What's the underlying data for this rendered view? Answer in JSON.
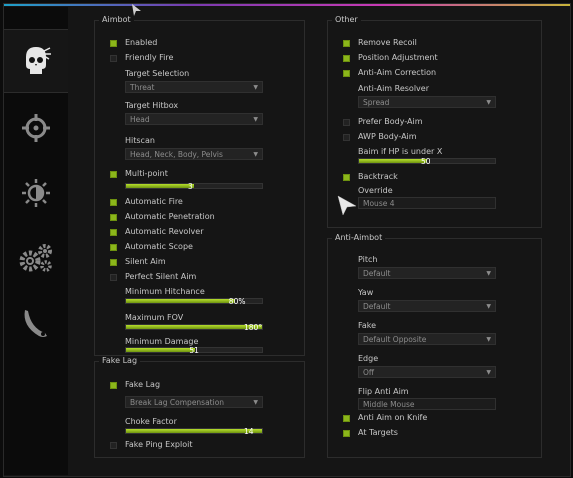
{
  "colors": {
    "accent": "#8bb61a",
    "panel": "#151515",
    "sidebar": "#0b0b0b"
  },
  "sidebar": {
    "tabs": [
      {
        "icon": "skull-icon",
        "active": true
      },
      {
        "icon": "crosshair-icon",
        "active": false
      },
      {
        "icon": "brightness-icon",
        "active": false
      },
      {
        "icon": "gears-icon",
        "active": false
      },
      {
        "icon": "knife-icon",
        "active": false
      }
    ]
  },
  "aimbot": {
    "title": "Aimbot",
    "enabled": {
      "label": "Enabled",
      "checked": true
    },
    "friendly_fire": {
      "label": "Friendly Fire",
      "checked": false
    },
    "target_selection": {
      "label": "Target Selection",
      "value": "Threat"
    },
    "target_hitbox": {
      "label": "Target Hitbox",
      "value": "Head"
    },
    "hitscan": {
      "label": "Hitscan",
      "value": "Head, Neck, Body, Pelvis"
    },
    "multipoint": {
      "label": "Multi-point",
      "checked": true,
      "value": "3",
      "fraction": 0.5
    },
    "automatic_fire": {
      "label": "Automatic Fire",
      "checked": true
    },
    "automatic_penetration": {
      "label": "Automatic Penetration",
      "checked": true
    },
    "automatic_revolver": {
      "label": "Automatic Revolver",
      "checked": true
    },
    "automatic_scope": {
      "label": "Automatic Scope",
      "checked": true
    },
    "silent_aim": {
      "label": "Silent Aim",
      "checked": true
    },
    "perfect_silent_aim": {
      "label": "Perfect Silent Aim",
      "checked": false
    },
    "minimum_hitchance": {
      "label": "Minimum Hitchance",
      "value": "80%",
      "fraction": 0.8
    },
    "maximum_fov": {
      "label": "Maximum FOV",
      "value": "180°",
      "fraction": 1.0
    },
    "minimum_damage": {
      "label": "Minimum Damage",
      "value": "51",
      "fraction": 0.51
    }
  },
  "fakelag": {
    "title": "Fake Lag",
    "fake_lag": {
      "label": "Fake Lag",
      "checked": true
    },
    "mode": {
      "value": "Break Lag Compensation"
    },
    "choke_factor": {
      "label": "Choke Factor",
      "value": "14",
      "fraction": 1.0
    },
    "fake_ping": {
      "label": "Fake Ping Exploit",
      "checked": false
    }
  },
  "other": {
    "title": "Other",
    "remove_recoil": {
      "label": "Remove Recoil",
      "checked": true
    },
    "position_adjustment": {
      "label": "Position Adjustment",
      "checked": true
    },
    "anti_aim_correction": {
      "label": "Anti-Aim Correction",
      "checked": true
    },
    "anti_aim_resolver": {
      "label": "Anti-Aim Resolver",
      "value": "Spread"
    },
    "prefer_body_aim": {
      "label": "Prefer Body-Aim",
      "checked": false
    },
    "awp_body_aim": {
      "label": "AWP Body-Aim",
      "checked": false
    },
    "baim_hp": {
      "label": "Baim if HP is under X",
      "value": "50",
      "fraction": 0.5
    },
    "backtrack": {
      "label": "Backtrack",
      "checked": true
    },
    "override": {
      "label": "Override",
      "value": "Mouse 4"
    }
  },
  "antiaim": {
    "title": "Anti-Aimbot",
    "pitch": {
      "label": "Pitch",
      "value": "Default"
    },
    "yaw": {
      "label": "Yaw",
      "value": "Default"
    },
    "fake": {
      "label": "Fake",
      "value": "Default Opposite"
    },
    "edge": {
      "label": "Edge",
      "value": "Off"
    },
    "flip": {
      "label": "Flip Anti Aim",
      "value": "Middle Mouse"
    },
    "anti_aim_on_knife": {
      "label": "Anti Aim on Knife",
      "checked": true
    },
    "at_targets": {
      "label": "At Targets",
      "checked": true
    }
  }
}
